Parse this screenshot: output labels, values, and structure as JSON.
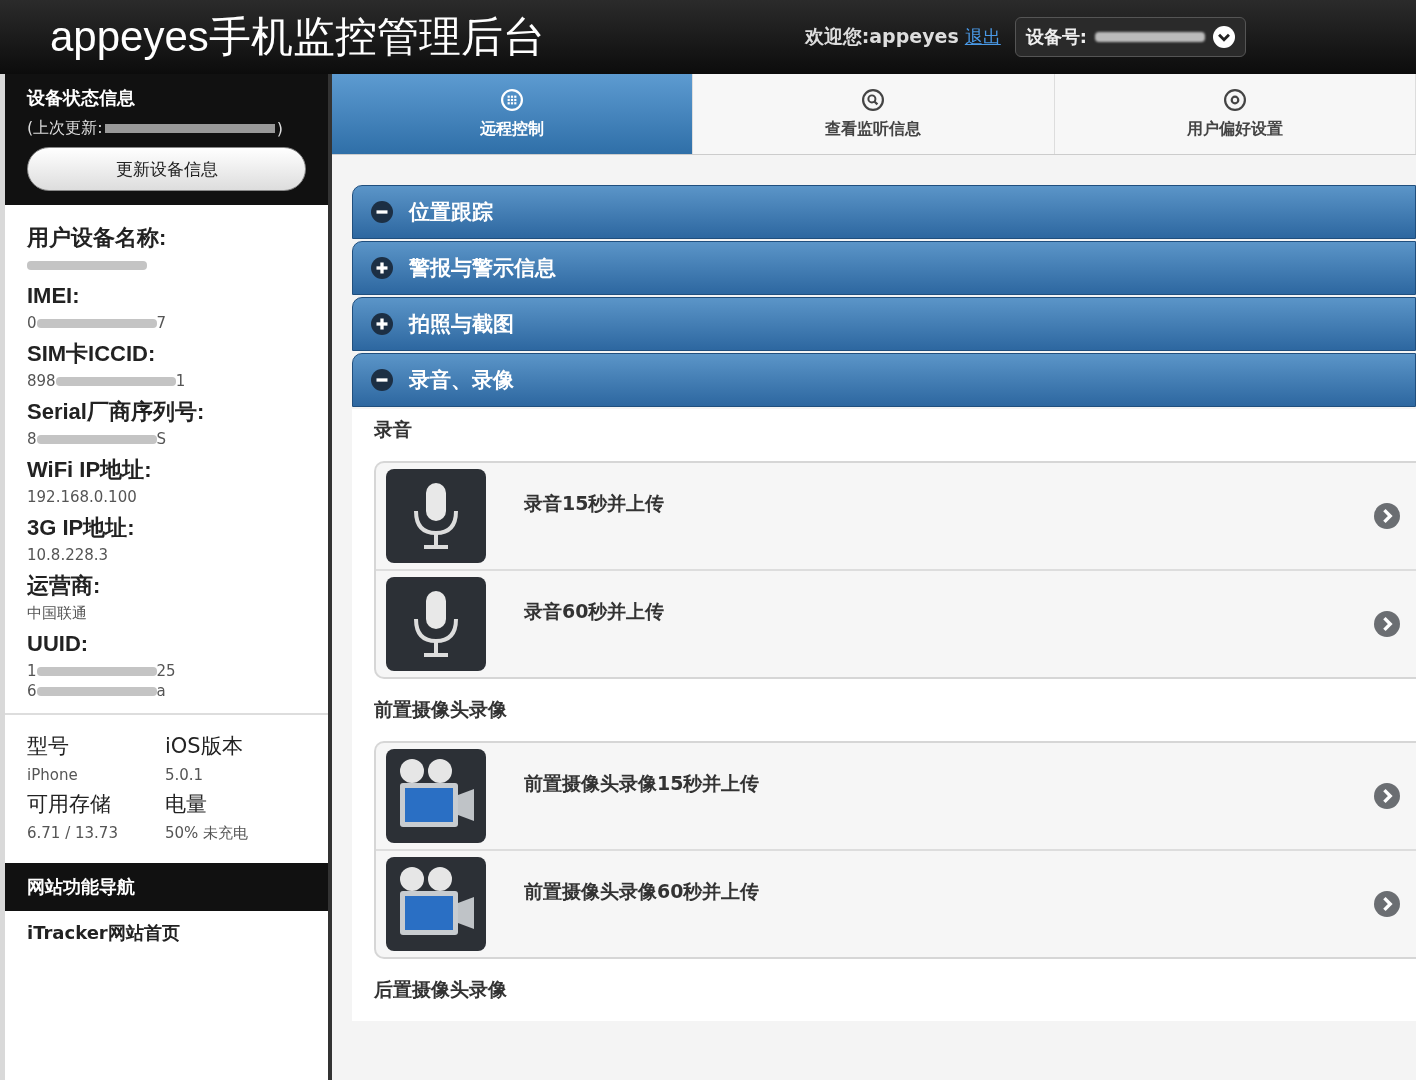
{
  "header": {
    "title": "appeyes手机监控管理后台",
    "welcome": "欢迎您:appeyes",
    "logout": "退出",
    "device_select": {
      "label": "设备号:",
      "redacted": true
    }
  },
  "sidebar": {
    "status_title": "设备状态信息",
    "last_update": {
      "prefix": "(上次更新:",
      "suffix": ")",
      "redacted": true
    },
    "update_button": "更新设备信息",
    "fields": [
      {
        "label": "用户设备名称:",
        "segments": [
          {
            "kind": "blur"
          }
        ]
      },
      {
        "label": "IMEI:",
        "segments": [
          {
            "kind": "text",
            "text": "0"
          },
          {
            "kind": "blur"
          },
          {
            "kind": "text",
            "text": "7"
          }
        ]
      },
      {
        "label": "SIM卡ICCID:",
        "segments": [
          {
            "kind": "text",
            "text": "898"
          },
          {
            "kind": "blur"
          },
          {
            "kind": "text",
            "text": "1"
          }
        ]
      },
      {
        "label": "Serial厂商序列号:",
        "segments": [
          {
            "kind": "text",
            "text": "8"
          },
          {
            "kind": "blur"
          },
          {
            "kind": "text",
            "text": "S"
          }
        ]
      },
      {
        "label": "WiFi IP地址:",
        "segments": [
          {
            "kind": "text",
            "text": "192.168.0.100"
          }
        ]
      },
      {
        "label": "3G IP地址:",
        "segments": [
          {
            "kind": "text",
            "text": "10.8.228.3"
          }
        ]
      },
      {
        "label": "运营商:",
        "segments": [
          {
            "kind": "text",
            "text": "中国联通"
          }
        ]
      },
      {
        "label": "UUID:",
        "segments": [
          {
            "kind": "text",
            "text": "1"
          },
          {
            "kind": "blur"
          },
          {
            "kind": "text",
            "text": "25"
          },
          {
            "kind": "break"
          },
          {
            "kind": "text",
            "text": "6"
          },
          {
            "kind": "blur"
          },
          {
            "kind": "text",
            "text": "a"
          }
        ]
      }
    ],
    "specs": [
      {
        "label": "型号",
        "value": "iPhone"
      },
      {
        "label": "iOS版本",
        "value": "5.0.1"
      },
      {
        "label": "可用存储",
        "value": "6.71 / 13.73"
      },
      {
        "label": "电量",
        "value": "50% 未充电"
      }
    ],
    "nav_title": "网站功能导航",
    "nav_items": [
      {
        "label": "iTracker网站首页"
      }
    ]
  },
  "tabs": [
    {
      "label": "远程控制",
      "selected": true
    },
    {
      "label": "查看监听信息",
      "selected": false
    },
    {
      "label": "用户偏好设置",
      "selected": false
    }
  ],
  "sections": [
    {
      "title": "位置跟踪",
      "expanded": true
    },
    {
      "title": "警报与警示信息",
      "expanded": false
    },
    {
      "title": "拍照与截图",
      "expanded": false
    },
    {
      "title": "录音、录像",
      "expanded": true,
      "groups": [
        {
          "title": "录音",
          "items": [
            {
              "label": "录音15秒并上传",
              "kind": "mic"
            },
            {
              "label": "录音60秒并上传",
              "kind": "mic"
            }
          ]
        },
        {
          "title": "前置摄像头录像",
          "items": [
            {
              "label": "前置摄像头录像15秒并上传",
              "kind": "camera"
            },
            {
              "label": "前置摄像头录像60秒并上传",
              "kind": "camera"
            }
          ]
        },
        {
          "title": "后置摄像头录像"
        }
      ]
    }
  ]
}
